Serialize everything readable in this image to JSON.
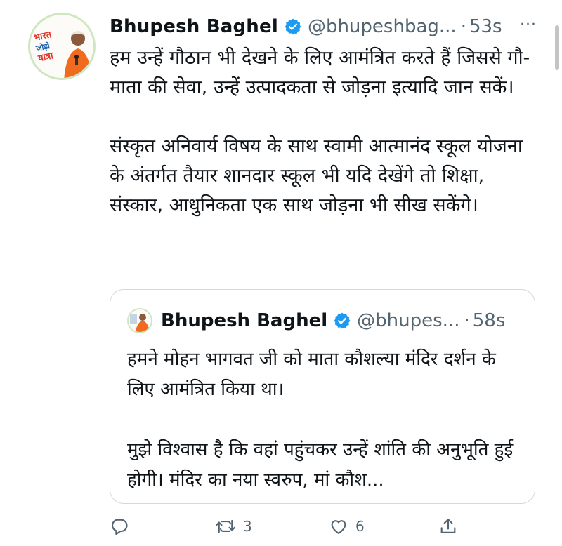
{
  "tweet": {
    "author_name": "Bhupesh Baghel",
    "handle": "@bhupeshbag...",
    "separator": "·",
    "time": "53s",
    "more_label": "···",
    "avatar_logo_lines": [
      "भारत",
      "जोड़ो",
      "यात्रा"
    ],
    "body": "हम उन्हें गौठान भी देखने के लिए आमंत्रित करते हैं जिससे गौ-माता की सेवा, उन्हें उत्पादकता से जोड़ना इत्यादि जान सकें।\n\nसंस्कृत अनिवार्य विषय के साथ स्वामी आत्मानंद स्कूल योजना के अंतर्गत तैयार शानदार स्कूल भी यदि देखेंगे तो शिक्षा, संस्कार, आधुनिकता एक साथ जोड़ना भी सीख सकेंगे।"
  },
  "quoted_tweet": {
    "author_name": "Bhupesh Baghel",
    "handle": "@bhupes...",
    "separator": "·",
    "time": "58s",
    "body": "हमने मोहन भागवत जी को माता कौशल्या मंदिर दर्शन के लिए आमंत्रित किया था।\n\nमुझे विश्वास है कि वहां पहुंचकर उन्हें शांति की अनुभूति हुई होगी। मंदिर का नया स्वरुप, मां कौश..."
  },
  "actions": {
    "reply_icon": "reply-icon",
    "retweet_icon": "retweet-icon",
    "retweet_count": "3",
    "like_icon": "heart-icon",
    "like_count": "6",
    "share_icon": "share-icon"
  },
  "colors": {
    "verified": "#1d9bf0",
    "secondary_text": "#536471",
    "border": "#cfd9de"
  }
}
